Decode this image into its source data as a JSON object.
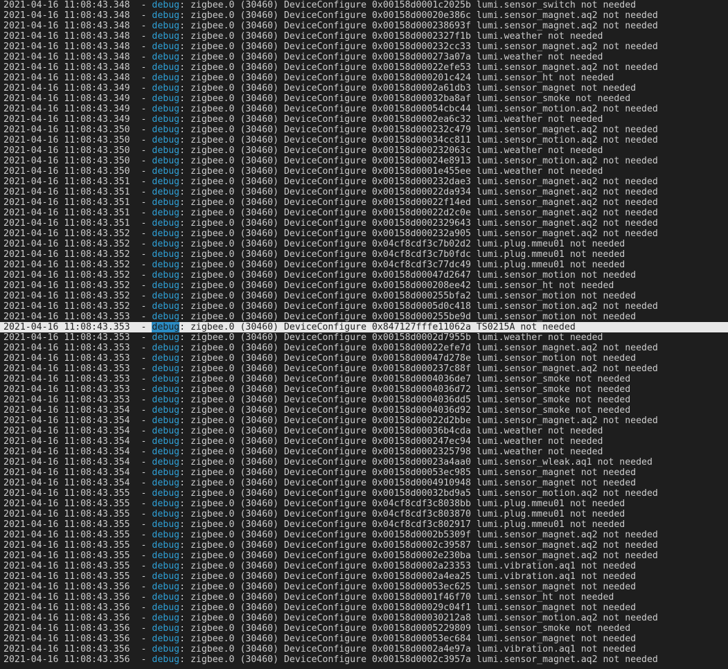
{
  "terminal": {
    "level_label": "debug",
    "selected_index": 31,
    "lines": [
      {
        "ts": "2021-04-16 11:08:43.348",
        "msg": "zigbee.0 (30460) DeviceConfigure 0x00158d0001c2025b lumi.sensor_switch not needed"
      },
      {
        "ts": "2021-04-16 11:08:43.348",
        "msg": "zigbee.0 (30460) DeviceConfigure 0x00158d00020e386c lumi.sensor_magnet.aq2 not needed"
      },
      {
        "ts": "2021-04-16 11:08:43.348",
        "msg": "zigbee.0 (30460) DeviceConfigure 0x00158d000238693f lumi.sensor_magnet.aq2 not needed"
      },
      {
        "ts": "2021-04-16 11:08:43.348",
        "msg": "zigbee.0 (30460) DeviceConfigure 0x00158d0002327f1b lumi.weather not needed"
      },
      {
        "ts": "2021-04-16 11:08:43.348",
        "msg": "zigbee.0 (30460) DeviceConfigure 0x00158d000232cc33 lumi.sensor_magnet.aq2 not needed"
      },
      {
        "ts": "2021-04-16 11:08:43.348",
        "msg": "zigbee.0 (30460) DeviceConfigure 0x00158d000273a07a lumi.weather not needed"
      },
      {
        "ts": "2021-04-16 11:08:43.348",
        "msg": "zigbee.0 (30460) DeviceConfigure 0x00158d00022efe53 lumi.sensor_magnet.aq2 not needed"
      },
      {
        "ts": "2021-04-16 11:08:43.348",
        "msg": "zigbee.0 (30460) DeviceConfigure 0x00158d000201c424 lumi.sensor_ht not needed"
      },
      {
        "ts": "2021-04-16 11:08:43.349",
        "msg": "zigbee.0 (30460) DeviceConfigure 0x00158d0002a61db3 lumi.sensor_magnet not needed"
      },
      {
        "ts": "2021-04-16 11:08:43.349",
        "msg": "zigbee.0 (30460) DeviceConfigure 0x00158d00032ba8af lumi.sensor_smoke not needed"
      },
      {
        "ts": "2021-04-16 11:08:43.349",
        "msg": "zigbee.0 (30460) DeviceConfigure 0x00158d00054cbc44 lumi.sensor_motion.aq2 not needed"
      },
      {
        "ts": "2021-04-16 11:08:43.349",
        "msg": "zigbee.0 (30460) DeviceConfigure 0x00158d0002ea6c32 lumi.weather not needed"
      },
      {
        "ts": "2021-04-16 11:08:43.350",
        "msg": "zigbee.0 (30460) DeviceConfigure 0x00158d000232c479 lumi.sensor_magnet.aq2 not needed"
      },
      {
        "ts": "2021-04-16 11:08:43.350",
        "msg": "zigbee.0 (30460) DeviceConfigure 0x00158d00034cc811 lumi.sensor_motion.aq2 not needed"
      },
      {
        "ts": "2021-04-16 11:08:43.350",
        "msg": "zigbee.0 (30460) DeviceConfigure 0x00158d000232063c lumi.weather not needed"
      },
      {
        "ts": "2021-04-16 11:08:43.350",
        "msg": "zigbee.0 (30460) DeviceConfigure 0x00158d00024e8913 lumi.sensor_motion.aq2 not needed"
      },
      {
        "ts": "2021-04-16 11:08:43.350",
        "msg": "zigbee.0 (30460) DeviceConfigure 0x00158d0001e455ee lumi.weather not needed"
      },
      {
        "ts": "2021-04-16 11:08:43.351",
        "msg": "zigbee.0 (30460) DeviceConfigure 0x00158d000232dae3 lumi.sensor_magnet.aq2 not needed"
      },
      {
        "ts": "2021-04-16 11:08:43.351",
        "msg": "zigbee.0 (30460) DeviceConfigure 0x00158d00022da934 lumi.sensor_magnet.aq2 not needed"
      },
      {
        "ts": "2021-04-16 11:08:43.351",
        "msg": "zigbee.0 (30460) DeviceConfigure 0x00158d00022f14ed lumi.sensor_magnet.aq2 not needed"
      },
      {
        "ts": "2021-04-16 11:08:43.351",
        "msg": "zigbee.0 (30460) DeviceConfigure 0x00158d00022d2c0e lumi.sensor_magnet.aq2 not needed"
      },
      {
        "ts": "2021-04-16 11:08:43.351",
        "msg": "zigbee.0 (30460) DeviceConfigure 0x00158d0002329643 lumi.sensor_magnet.aq2 not needed"
      },
      {
        "ts": "2021-04-16 11:08:43.352",
        "msg": "zigbee.0 (30460) DeviceConfigure 0x00158d000232a905 lumi.sensor_magnet.aq2 not needed"
      },
      {
        "ts": "2021-04-16 11:08:43.352",
        "msg": "zigbee.0 (30460) DeviceConfigure 0x04cf8cdf3c7b02d2 lumi.plug.mmeu01 not needed"
      },
      {
        "ts": "2021-04-16 11:08:43.352",
        "msg": "zigbee.0 (30460) DeviceConfigure 0x04cf8cdf3c7b0fdc lumi.plug.mmeu01 not needed"
      },
      {
        "ts": "2021-04-16 11:08:43.352",
        "msg": "zigbee.0 (30460) DeviceConfigure 0x04cf8cdf3c77dc49 lumi.plug.mmeu01 not needed"
      },
      {
        "ts": "2021-04-16 11:08:43.352",
        "msg": "zigbee.0 (30460) DeviceConfigure 0x00158d00047d2647 lumi.sensor_motion not needed"
      },
      {
        "ts": "2021-04-16 11:08:43.352",
        "msg": "zigbee.0 (30460) DeviceConfigure 0x00158d000208ee42 lumi.sensor_ht not needed"
      },
      {
        "ts": "2021-04-16 11:08:43.352",
        "msg": "zigbee.0 (30460) DeviceConfigure 0x00158d000255bfa2 lumi.sensor_motion not needed"
      },
      {
        "ts": "2021-04-16 11:08:43.352",
        "msg": "zigbee.0 (30460) DeviceConfigure 0x00158d0005d0c418 lumi.sensor_motion.aq2 not needed"
      },
      {
        "ts": "2021-04-16 11:08:43.353",
        "msg": "zigbee.0 (30460) DeviceConfigure 0x00158d000255be9d lumi.sensor_motion not needed"
      },
      {
        "ts": "2021-04-16 11:08:43.353",
        "msg": "zigbee.0 (30460) DeviceConfigure 0x847127fffe11062a TS0215A not needed"
      },
      {
        "ts": "2021-04-16 11:08:43.353",
        "msg": "zigbee.0 (30460) DeviceConfigure 0x00158d0002d7955b lumi.weather not needed"
      },
      {
        "ts": "2021-04-16 11:08:43.353",
        "msg": "zigbee.0 (30460) DeviceConfigure 0x00158d00022efe7d lumi.sensor_magnet.aq2 not needed"
      },
      {
        "ts": "2021-04-16 11:08:43.353",
        "msg": "zigbee.0 (30460) DeviceConfigure 0x00158d00047d278e lumi.sensor_motion not needed"
      },
      {
        "ts": "2021-04-16 11:08:43.353",
        "msg": "zigbee.0 (30460) DeviceConfigure 0x00158d000237c88f lumi.sensor_magnet.aq2 not needed"
      },
      {
        "ts": "2021-04-16 11:08:43.353",
        "msg": "zigbee.0 (30460) DeviceConfigure 0x00158d0004036de7 lumi.sensor_smoke not needed"
      },
      {
        "ts": "2021-04-16 11:08:43.353",
        "msg": "zigbee.0 (30460) DeviceConfigure 0x00158d0004036d72 lumi.sensor_smoke not needed"
      },
      {
        "ts": "2021-04-16 11:08:43.353",
        "msg": "zigbee.0 (30460) DeviceConfigure 0x00158d0004036dd5 lumi.sensor_smoke not needed"
      },
      {
        "ts": "2021-04-16 11:08:43.354",
        "msg": "zigbee.0 (30460) DeviceConfigure 0x00158d0004036d92 lumi.sensor_smoke not needed"
      },
      {
        "ts": "2021-04-16 11:08:43.354",
        "msg": "zigbee.0 (30460) DeviceConfigure 0x00158d00022d2bbe lumi.sensor_magnet.aq2 not needed"
      },
      {
        "ts": "2021-04-16 11:08:43.354",
        "msg": "zigbee.0 (30460) DeviceConfigure 0x00158d00036b4cda lumi.weather not needed"
      },
      {
        "ts": "2021-04-16 11:08:43.354",
        "msg": "zigbee.0 (30460) DeviceConfigure 0x00158d000247ec94 lumi.weather not needed"
      },
      {
        "ts": "2021-04-16 11:08:43.354",
        "msg": "zigbee.0 (30460) DeviceConfigure 0x00158d0002325798 lumi.weather not needed"
      },
      {
        "ts": "2021-04-16 11:08:43.354",
        "msg": "zigbee.0 (30460) DeviceConfigure 0x00158d00023a4aa0 lumi.sensor_wleak.aq1 not needed"
      },
      {
        "ts": "2021-04-16 11:08:43.354",
        "msg": "zigbee.0 (30460) DeviceConfigure 0x00158d00053ec985 lumi.sensor_magnet not needed"
      },
      {
        "ts": "2021-04-16 11:08:43.354",
        "msg": "zigbee.0 (30460) DeviceConfigure 0x00158d0004910948 lumi.sensor_magnet not needed"
      },
      {
        "ts": "2021-04-16 11:08:43.355",
        "msg": "zigbee.0 (30460) DeviceConfigure 0x00158d00032bd9a5 lumi.sensor_motion.aq2 not needed"
      },
      {
        "ts": "2021-04-16 11:08:43.355",
        "msg": "zigbee.0 (30460) DeviceConfigure 0x04cf8cdf3c8038bb lumi.plug.mmeu01 not needed"
      },
      {
        "ts": "2021-04-16 11:08:43.355",
        "msg": "zigbee.0 (30460) DeviceConfigure 0x04cf8cdf3c803870 lumi.plug.mmeu01 not needed"
      },
      {
        "ts": "2021-04-16 11:08:43.355",
        "msg": "zigbee.0 (30460) DeviceConfigure 0x04cf8cdf3c802917 lumi.plug.mmeu01 not needed"
      },
      {
        "ts": "2021-04-16 11:08:43.355",
        "msg": "zigbee.0 (30460) DeviceConfigure 0x00158d0002b5309f lumi.sensor_magnet.aq2 not needed"
      },
      {
        "ts": "2021-04-16 11:08:43.355",
        "msg": "zigbee.0 (30460) DeviceConfigure 0x00158d0002c39587 lumi.sensor_magnet.aq2 not needed"
      },
      {
        "ts": "2021-04-16 11:08:43.355",
        "msg": "zigbee.0 (30460) DeviceConfigure 0x00158d0002e230ba lumi.sensor_magnet.aq2 not needed"
      },
      {
        "ts": "2021-04-16 11:08:43.355",
        "msg": "zigbee.0 (30460) DeviceConfigure 0x00158d0002a23353 lumi.vibration.aq1 not needed"
      },
      {
        "ts": "2021-04-16 11:08:43.355",
        "msg": "zigbee.0 (30460) DeviceConfigure 0x00158d0002a4ea25 lumi.vibration.aq1 not needed"
      },
      {
        "ts": "2021-04-16 11:08:43.356",
        "msg": "zigbee.0 (30460) DeviceConfigure 0x00158d00053ec625 lumi.sensor_magnet not needed"
      },
      {
        "ts": "2021-04-16 11:08:43.356",
        "msg": "zigbee.0 (30460) DeviceConfigure 0x00158d0001f46f70 lumi.sensor_ht not needed"
      },
      {
        "ts": "2021-04-16 11:08:43.356",
        "msg": "zigbee.0 (30460) DeviceConfigure 0x00158d00029c04f1 lumi.sensor_magnet not needed"
      },
      {
        "ts": "2021-04-16 11:08:43.356",
        "msg": "zigbee.0 (30460) DeviceConfigure 0x00158d00030212a8 lumi.sensor_motion.aq2 not needed"
      },
      {
        "ts": "2021-04-16 11:08:43.356",
        "msg": "zigbee.0 (30460) DeviceConfigure 0x00158d0005229809 lumi.sensor_smoke not needed"
      },
      {
        "ts": "2021-04-16 11:08:43.356",
        "msg": "zigbee.0 (30460) DeviceConfigure 0x00158d00053ec684 lumi.sensor_magnet not needed"
      },
      {
        "ts": "2021-04-16 11:08:43.356",
        "msg": "zigbee.0 (30460) DeviceConfigure 0x00158d0002a4e97a lumi.vibration.aq1 not needed"
      },
      {
        "ts": "2021-04-16 11:08:43.356",
        "msg": "zigbee.0 (30460) DeviceConfigure 0x00158d0002c3957a lumi.sensor_magnet.aq2 not needed"
      }
    ]
  },
  "colors": {
    "background": "#1e1e1e",
    "text": "#cccccc",
    "level": "#2fa0d6",
    "selection": "#e8e8e8"
  }
}
